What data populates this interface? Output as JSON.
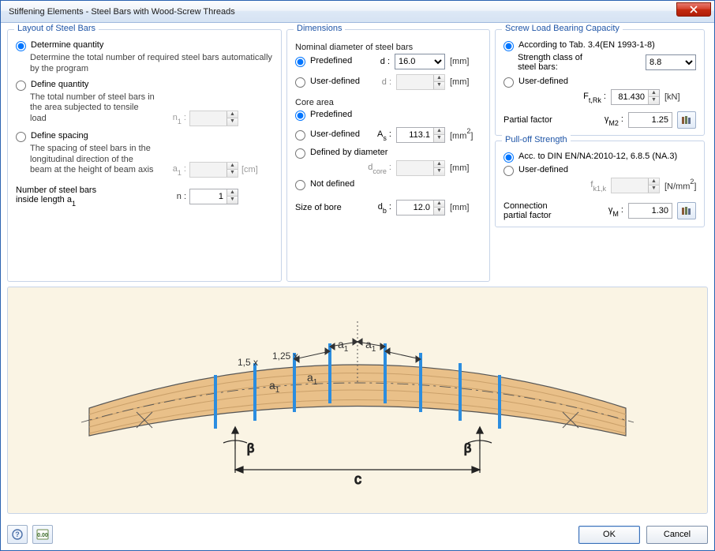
{
  "window": {
    "title": "Stiffening Elements - Steel Bars with Wood-Screw Threads"
  },
  "layout": {
    "legend": "Layout of Steel Bars",
    "opt_determine": "Determine quantity",
    "opt_determine_desc": "Determine the total number of required steel bars automatically by the program",
    "opt_define_qty": "Define quantity",
    "opt_define_qty_desc": "The total number of steel bars in the area subjected to tensile load",
    "n1_label": "n₁ :",
    "n1_val": "",
    "opt_define_spacing": "Define spacing",
    "opt_define_spacing_desc": "The spacing of steel bars in the longitudinal direction of the beam at the height of beam axis",
    "a1_label": "a₁ :",
    "a1_unit": "[cm]",
    "num_bars_label": "Number of steel bars\ninside length a₁",
    "n_label": "n :",
    "n_val": "1"
  },
  "dimensions": {
    "legend": "Dimensions",
    "nominal": "Nominal diameter of steel bars",
    "predefined": "Predefined",
    "userdef": "User-defined",
    "d_label": "d :",
    "d_val": "16.0",
    "d_unit": "[mm]",
    "core": "Core area",
    "as_label": "Aₛ :",
    "as_val": "113.1",
    "as_unit": "[mm²]",
    "defined_by_diam": "Defined by diameter",
    "dcore_label": "dₒₒᵣₑ :",
    "dcore_display": "dcore :",
    "dcore_unit": "[mm]",
    "not_def": "Not defined",
    "bore": "Size of bore",
    "db_label": "dᵇ :",
    "db_val": "12.0",
    "db_unit": "[mm]"
  },
  "screw": {
    "legend": "Screw Load Bearing Capacity",
    "according": "According to Tab. 3.4(EN 1993-1-8)",
    "strength_label": "Strength class of\nsteel bars:",
    "strength_val": "8.8",
    "userdef": "User-defined",
    "ftrk_label": "Fₜ,ᵣₖ :",
    "ftrk_display": "Ft,Rk :",
    "ftrk_val": "81.430",
    "ftrk_unit": "[kN]",
    "partial": "Partial factor",
    "gm2_label": "γM2 :",
    "gm2_val": "1.25"
  },
  "pulloff": {
    "legend": "Pull-off Strength",
    "acc": "Acc. to DIN EN/NA:2010-12, 6.8.5 (NA.3)",
    "userdef": "User-defined",
    "fk1_label": "fₖ₁,ₖ",
    "fk1_display": "fk1,k",
    "fk1_unit": "[N/mm²]",
    "conn": "Connection\npartial factor",
    "gm_label": "γM :",
    "gm_val": "1.30"
  },
  "buttons": {
    "ok": "OK",
    "cancel": "Cancel"
  },
  "chart_data": {
    "type": "diagram",
    "description": "Curved glulam beam apex region cross-section with vertical stiffening steel bars",
    "labels": [
      "1,5 x",
      "1,25 x",
      "a₁",
      "a₁",
      "a₁",
      "a₁",
      "β",
      "β",
      "c"
    ],
    "n_bars_shown": 8,
    "span_label": "c",
    "angle_label": "β",
    "spacing_label": "a₁",
    "multipliers": [
      "1,5 x",
      "1,25 x"
    ]
  }
}
